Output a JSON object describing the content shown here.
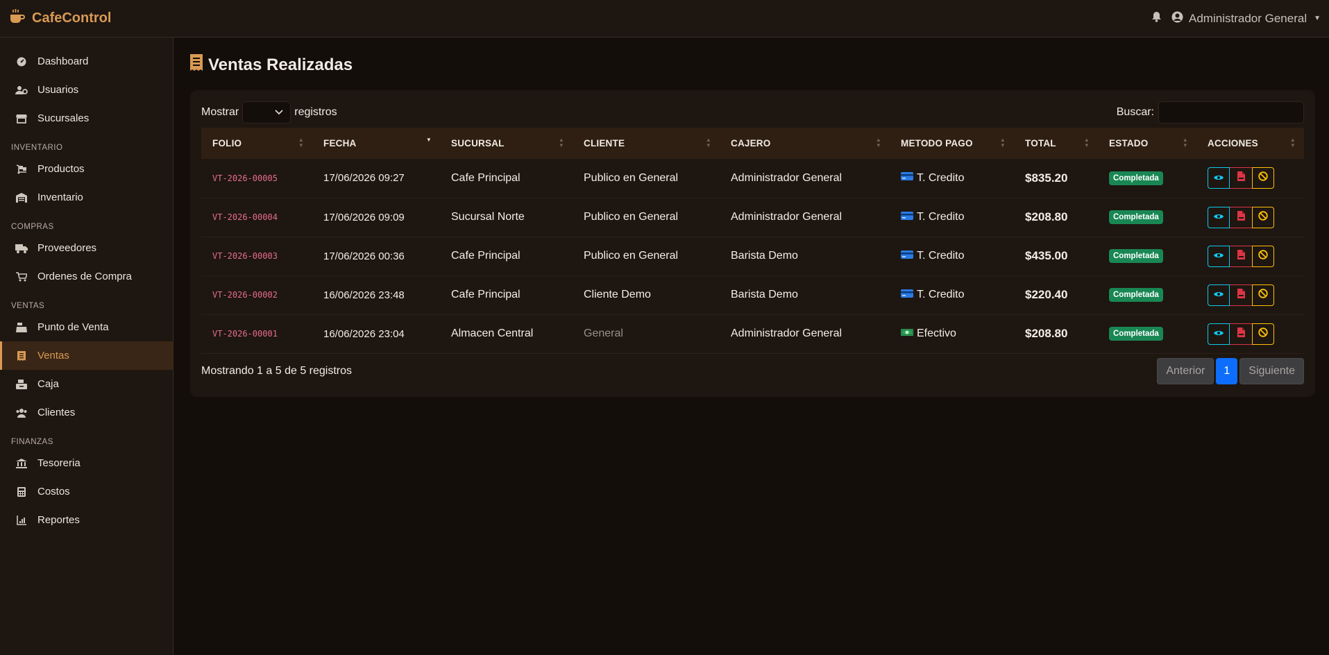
{
  "app": {
    "brand": "CafeControl"
  },
  "navbar": {
    "user": "Administrador General"
  },
  "sidebar": {
    "items_main": [
      {
        "label": "Dashboard",
        "icon": "dashboard-icon"
      },
      {
        "label": "Usuarios",
        "icon": "users-cog-icon"
      },
      {
        "label": "Sucursales",
        "icon": "store-icon"
      }
    ],
    "section_inventario": "INVENTARIO",
    "items_inventario": [
      {
        "label": "Productos",
        "icon": "dolly-icon"
      },
      {
        "label": "Inventario",
        "icon": "warehouse-icon"
      }
    ],
    "section_compras": "COMPRAS",
    "items_compras": [
      {
        "label": "Proveedores",
        "icon": "truck-icon"
      },
      {
        "label": "Ordenes de Compra",
        "icon": "cart-icon"
      }
    ],
    "section_ventas": "VENTAS",
    "items_ventas": [
      {
        "label": "Punto de Venta",
        "icon": "cash-register-icon"
      },
      {
        "label": "Ventas",
        "icon": "receipt-icon",
        "active": true
      },
      {
        "label": "Caja",
        "icon": "cash-box-icon"
      },
      {
        "label": "Clientes",
        "icon": "users-icon"
      }
    ],
    "section_finanzas": "FINANZAS",
    "items_finanzas": [
      {
        "label": "Tesoreria",
        "icon": "bank-icon"
      },
      {
        "label": "Costos",
        "icon": "calculator-icon"
      },
      {
        "label": "Reportes",
        "icon": "chart-icon"
      }
    ]
  },
  "page": {
    "title": "Ventas Realizadas"
  },
  "table_controls": {
    "show_label": "Mostrar",
    "records_label": "registros",
    "search_label": "Buscar:",
    "search_value": ""
  },
  "table": {
    "headers": [
      "FOLIO",
      "FECHA",
      "SUCURSAL",
      "CLIENTE",
      "CAJERO",
      "METODO PAGO",
      "TOTAL",
      "ESTADO",
      "ACCIONES"
    ],
    "rows": [
      {
        "folio": "VT-2026-00005",
        "fecha": "17/06/2026 09:27",
        "sucursal": "Cafe Principal",
        "cliente": "Publico en General",
        "cajero": "Administrador General",
        "metodo": "T. Credito",
        "total": "$835.20",
        "estado": "Completada"
      },
      {
        "folio": "VT-2026-00004",
        "fecha": "17/06/2026 09:09",
        "sucursal": "Sucursal Norte",
        "cliente": "Publico en General",
        "cajero": "Administrador General",
        "metodo": "T. Credito",
        "total": "$208.80",
        "estado": "Completada"
      },
      {
        "folio": "VT-2026-00003",
        "fecha": "17/06/2026 00:36",
        "sucursal": "Cafe Principal",
        "cliente": "Publico en General",
        "cajero": "Barista Demo",
        "metodo": "T. Credito",
        "total": "$435.00",
        "estado": "Completada"
      },
      {
        "folio": "VT-2026-00002",
        "fecha": "16/06/2026 23:48",
        "sucursal": "Cafe Principal",
        "cliente": "Cliente Demo",
        "cajero": "Barista Demo",
        "metodo": "T. Credito",
        "total": "$220.40",
        "estado": "Completada"
      },
      {
        "folio": "VT-2026-00001",
        "fecha": "16/06/2026 23:04",
        "sucursal": "Almacen Central",
        "cliente": "General",
        "cajero": "Administrador General",
        "metodo": "Efectivo",
        "total": "$208.80",
        "estado": "Completada"
      }
    ]
  },
  "footer": {
    "info": "Mostrando 1 a 5 de 5 registros",
    "prev": "Anterior",
    "page": "1",
    "next": "Siguiente"
  },
  "colors": {
    "accent": "#d99a54",
    "badge_success": "#198754",
    "folio": "#e76d8e",
    "page_active": "#0d6efd"
  }
}
